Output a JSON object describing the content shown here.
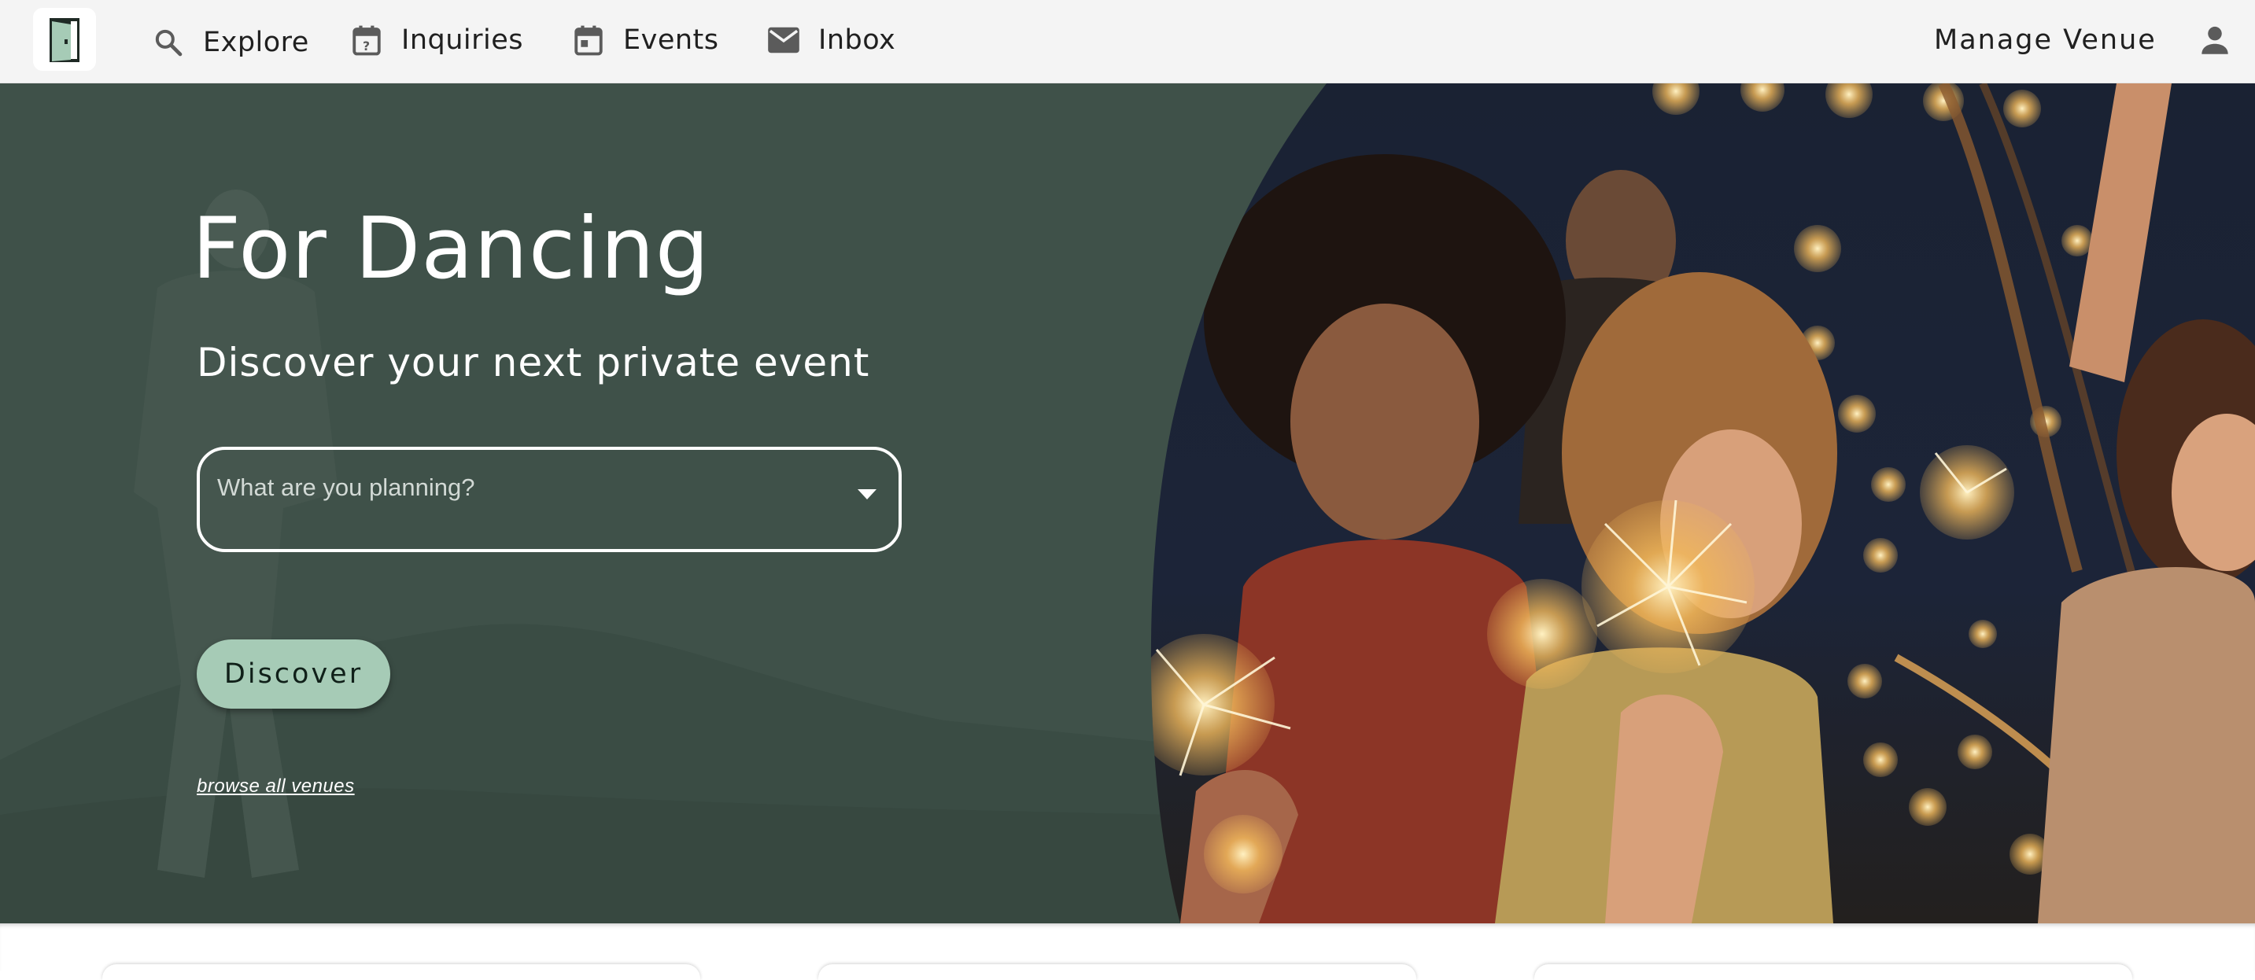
{
  "nav": {
    "logo": {
      "icon": "door-logo-icon"
    },
    "items": [
      {
        "label": "Explore",
        "icon": "search-icon"
      },
      {
        "label": "Inquiries",
        "icon": "calendar-question-icon"
      },
      {
        "label": "Events",
        "icon": "calendar-icon"
      },
      {
        "label": "Inbox",
        "icon": "mail-icon"
      }
    ],
    "manage_venue": "Manage Venue",
    "account_icon": "person-icon"
  },
  "hero": {
    "title": "For Dancing",
    "subtitle": "Discover your next private event",
    "search": {
      "placeholder": "What are you planning?",
      "icon": "dropdown-arrow-icon"
    },
    "discover_button": "Discover",
    "browse_link": "browse all venues",
    "image": "people-with-sparklers-photo"
  },
  "colors": {
    "nav_bg": "#f4f4f4",
    "hero_bg": "#3f5149",
    "accent": "#a6cbb6",
    "text_dark": "#202020"
  }
}
